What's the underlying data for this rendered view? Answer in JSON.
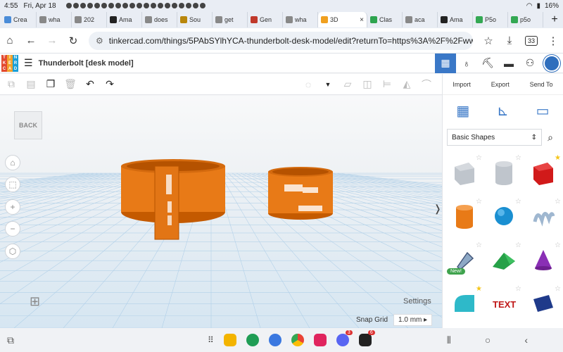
{
  "status": {
    "time": "4:55",
    "date": "Fri, Apr 18",
    "battery": "16%"
  },
  "tabs": [
    {
      "label": "Crea",
      "color": "#4a8cd8"
    },
    {
      "label": "wha",
      "color": "#888888"
    },
    {
      "label": "202",
      "color": "#888888"
    },
    {
      "label": "Ama",
      "color": "#222222"
    },
    {
      "label": "does",
      "color": "#888888"
    },
    {
      "label": "Sou",
      "color": "#b8860b"
    },
    {
      "label": "get",
      "color": "#888888"
    },
    {
      "label": "Gen",
      "color": "#c0392b"
    },
    {
      "label": "wha",
      "color": "#888888"
    },
    {
      "label": "3D",
      "color": "#f0a020",
      "active": true
    },
    {
      "label": "Clas",
      "color": "#2ea44f"
    },
    {
      "label": "aca",
      "color": "#888888"
    },
    {
      "label": "Ama",
      "color": "#222222"
    },
    {
      "label": "P5o",
      "color": "#34a853"
    },
    {
      "label": "p5o",
      "color": "#34a853"
    }
  ],
  "browser": {
    "url": "tinkercad.com/things/5PAbSYlhYCA-thunderbolt-desk-model/edit?returnTo=https%3A%2F%2Fwww.tinkerc",
    "tab_count": "33"
  },
  "app": {
    "logo_letters": [
      "T",
      "I",
      "N",
      "K",
      "E",
      "R",
      "C",
      "A",
      "D"
    ],
    "design_title": "Thunderbolt [desk model]"
  },
  "side": {
    "import": "Import",
    "export": "Export",
    "sendto": "Send To",
    "shape_set": "Basic Shapes",
    "new_badge": "New!"
  },
  "workplane": {
    "back": "BACK",
    "settings": "Settings",
    "snap_label": "Snap Grid",
    "snap_value": "1.0 mm"
  },
  "dock": {
    "badge_discord": "3",
    "badge_roblox": "6"
  }
}
